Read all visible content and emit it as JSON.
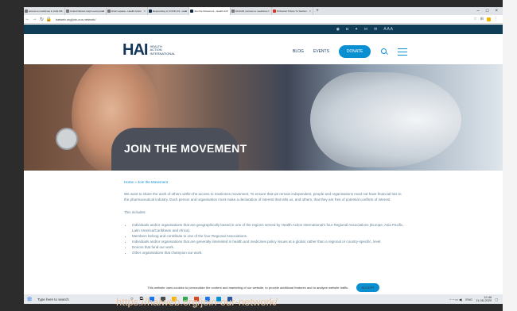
{
  "browser": {
    "tabs": [
      {
        "label": "access to medicines in india WI"
      },
      {
        "label": "United Nations High Level panel"
      },
      {
        "label": "Hindi Lapatta - Health Action"
      },
      {
        "label": "Responding to COVID-19 - Heal"
      },
      {
        "label": "Join the Movement - Health Act"
      },
      {
        "label": "OHCHR | access to medicines"
      },
      {
        "label": "8 Musical Tribute To Sushan"
      }
    ],
    "address": "haiweb.org/join-our-network/"
  },
  "site": {
    "logo": "HAI",
    "logo_sub": [
      "HEALTH",
      "ACTION",
      "INTERNATIONAL"
    ],
    "nav": {
      "blog": "BLOG",
      "events": "EVENTS",
      "donate": "DONATE"
    },
    "font_sizes": "A A A"
  },
  "hero": {
    "title": "JOIN THE MOVEMENT"
  },
  "content": {
    "breadcrumb": "Home » Join the Movement",
    "intro": "We want to share the work of others within the access to medicines movement. To ensure that we remain independent, people and organisations must not have financial ties to the pharmaceutical industry. Each person and organisation must make a declaration of interest that tells us, and others, that they are free of potential conflicts of interest.",
    "includes": "This includes:",
    "items": [
      "Individuals and/or organisations that are geographically based in one of the regions served by Health Action International's four Regional Associations (Europe, Asia Pacific, Latin America/Caribbean and Africa).",
      "Members belong and contribute to one of the four Regional Associations.",
      "Individuals and/or organisations that are generally interested in health and medicines policy issues at a global, rather than a regional or country-specific, level.",
      "Donors that fund our work.",
      "Other organisations that champion our work."
    ]
  },
  "cookie": {
    "text": "This website uses cookies to personalize the content and marketing of our website, to provide additional features and to analyze website traffic.",
    "accept": "ACCEPT"
  },
  "taskbar": {
    "search": "Type here to search",
    "lang": "ENG",
    "time": "12:46",
    "date": "11-08-2020"
  },
  "caption": "https://haiweb.org/join-our-network/",
  "colors": {
    "accent": "#0a8fd1",
    "navy": "#12365a",
    "topbar": "#0f3d57"
  }
}
